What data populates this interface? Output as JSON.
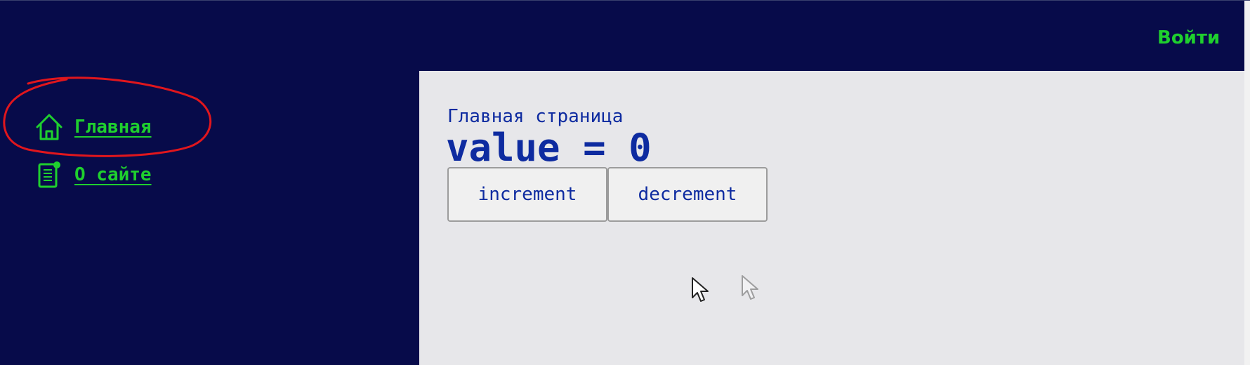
{
  "header": {
    "login_label": "Войти"
  },
  "sidebar": {
    "items": [
      {
        "label": "Главная",
        "icon": "home-icon"
      },
      {
        "label": "О сайте",
        "icon": "document-icon"
      }
    ]
  },
  "main": {
    "title": "Главная страница",
    "value_text": "value = 0",
    "buttons": {
      "increment_label": "increment",
      "decrement_label": "decrement"
    }
  },
  "colors": {
    "background": "#070b4a",
    "accent": "#1fd02e",
    "panel": "#e7e7ea",
    "text_primary": "#0e2ba0",
    "annotation": "#e0161d"
  }
}
